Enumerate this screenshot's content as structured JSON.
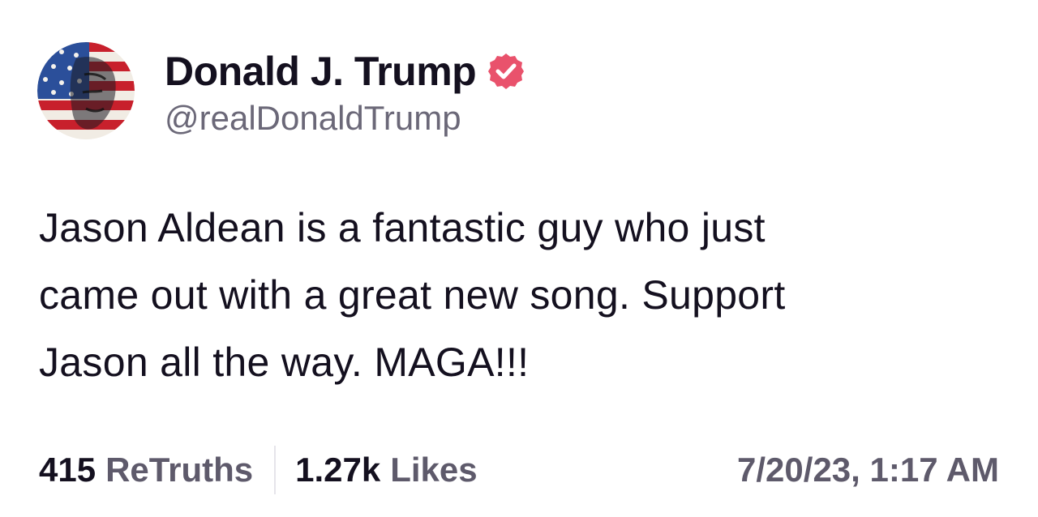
{
  "author": {
    "display_name": "Donald J. Trump",
    "handle": "@realDonaldTrump",
    "verified": true,
    "verified_color": "#e9526c",
    "avatar_icon": "flag-portrait-avatar"
  },
  "post": {
    "lines": [
      "Jason Aldean is a fantastic guy who just",
      "came out with a great new song. Support",
      "Jason all the way. MAGA!!!"
    ]
  },
  "stats": {
    "retruths_count": "415",
    "retruths_label": "ReTruths",
    "likes_count": "1.27k",
    "likes_label": "Likes"
  },
  "timestamp": "7/20/23, 1:17 AM"
}
